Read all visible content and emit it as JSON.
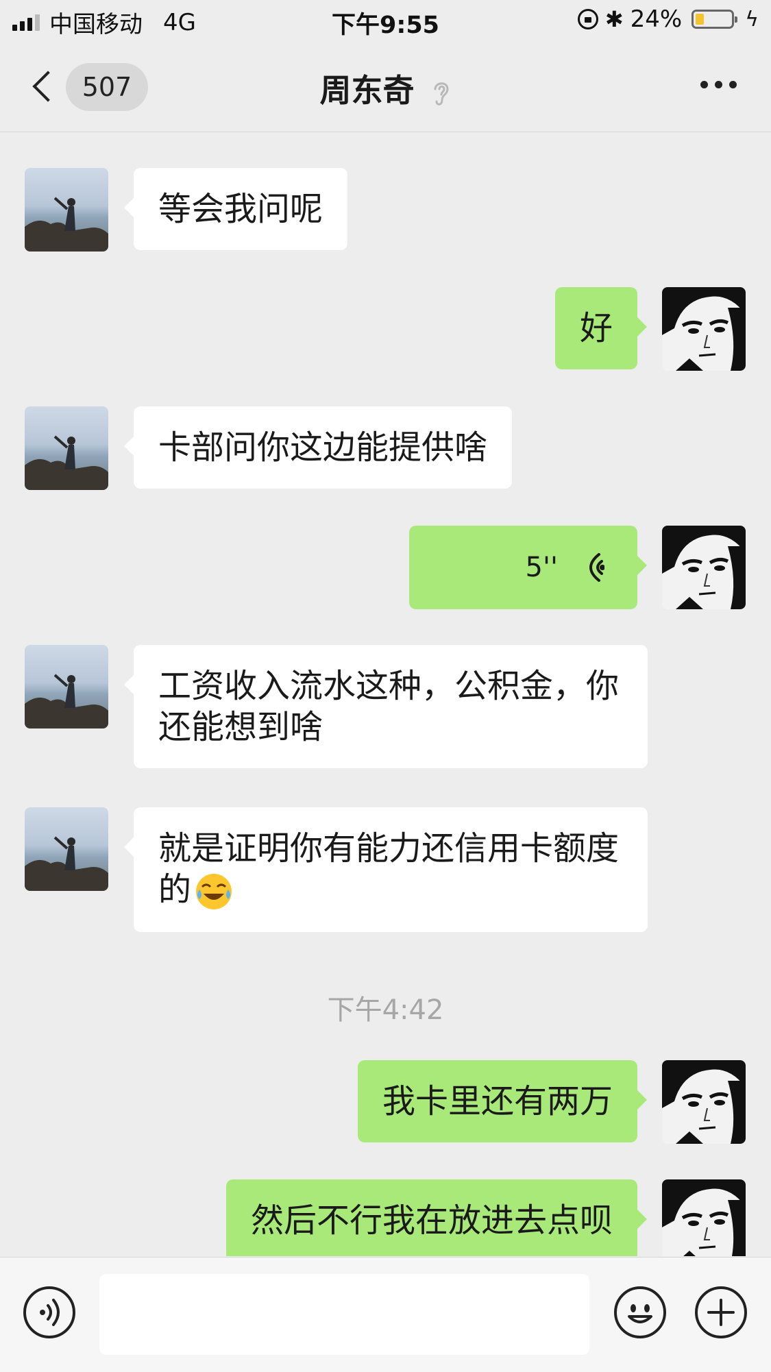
{
  "status_bar": {
    "carrier": "中国移动",
    "network": "4G",
    "time": "下午9:55",
    "battery_text": "24%",
    "battery_level": 0.24,
    "icons": [
      "signal-icon",
      "rotation-lock-icon",
      "bluetooth-icon",
      "battery-icon",
      "charging-icon"
    ]
  },
  "nav": {
    "unread_count": "507",
    "title": "周东奇",
    "icons": [
      "back-arrow-icon",
      "ear-icon",
      "more-icon"
    ]
  },
  "messages": [
    {
      "side": "left",
      "type": "text",
      "text": "等会我问呢"
    },
    {
      "side": "right",
      "type": "text",
      "text": "好"
    },
    {
      "side": "left",
      "type": "text",
      "text": "卡部问你这边能提供啥"
    },
    {
      "side": "right",
      "type": "voice",
      "duration": "5''"
    },
    {
      "side": "left",
      "type": "text",
      "text": "工资收入流水这种，公积金，你还能想到啥"
    },
    {
      "side": "left",
      "type": "text",
      "text": "就是证明你有能力还信用卡额度的",
      "emoji": "tears-of-joy-emoji"
    },
    {
      "type": "timestamp",
      "text": "下午4:42"
    },
    {
      "side": "right",
      "type": "text",
      "text": "我卡里还有两万"
    },
    {
      "side": "right",
      "type": "text",
      "text": "然后不行我在放进去点呗"
    }
  ],
  "input_bar": {
    "placeholder": "",
    "icons": [
      "voice-input-icon",
      "emoji-icon",
      "plus-icon"
    ]
  },
  "colors": {
    "background": "#ededed",
    "bubble_self": "#a9e97a",
    "bubble_other": "#ffffff",
    "timestamp": "#a6a6a6",
    "battery_fill": "#f4c430"
  }
}
